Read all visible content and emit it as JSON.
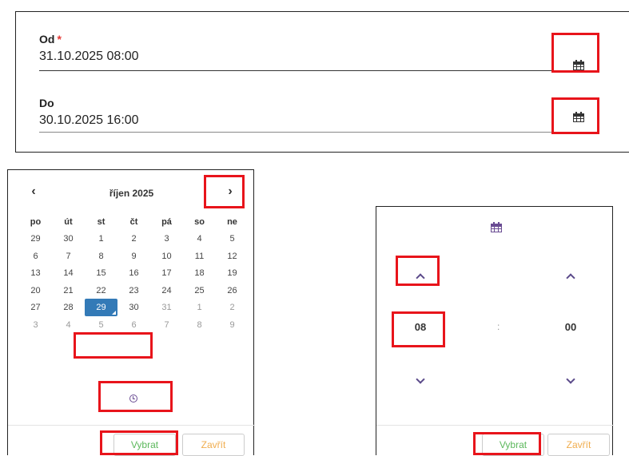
{
  "form": {
    "from": {
      "label": "Od",
      "required_mark": "*",
      "value": "31.10.2025 08:00",
      "calendar_icon": "calendar-icon"
    },
    "to": {
      "label": "Do",
      "value": "30.10.2025 16:00",
      "calendar_icon": "calendar-icon"
    }
  },
  "datepicker": {
    "prev_label": "‹",
    "next_label": "›",
    "month_title": "říjen 2025",
    "weekdays": [
      "po",
      "út",
      "st",
      "čt",
      "pá",
      "so",
      "ne"
    ],
    "weeks": [
      [
        "29",
        "30",
        "1",
        "2",
        "3",
        "4",
        "5"
      ],
      [
        "6",
        "7",
        "8",
        "9",
        "10",
        "11",
        "12"
      ],
      [
        "13",
        "14",
        "15",
        "16",
        "17",
        "18",
        "19"
      ],
      [
        "20",
        "21",
        "22",
        "23",
        "24",
        "25",
        "26"
      ],
      [
        "27",
        "28",
        "29",
        "30",
        "31",
        "1",
        "2"
      ],
      [
        "3",
        "4",
        "5",
        "6",
        "7",
        "8",
        "9"
      ]
    ],
    "selected_day": "29",
    "time_toggle_icon": "clock-icon",
    "ok_label": "Vybrat",
    "close_label": "Zavřít"
  },
  "timepicker": {
    "header_icon": "calendar-icon",
    "hours": "08",
    "separator": ":",
    "minutes": "00",
    "ok_label": "Vybrat",
    "close_label": "Zavřít"
  },
  "colors": {
    "accent_purple": "#6a4c93",
    "selected_blue": "#337ab7",
    "ok_green": "#5cb85c",
    "close_orange": "#f0ad4e",
    "highlight_red": "#e8141b",
    "required_red": "#e53935"
  }
}
